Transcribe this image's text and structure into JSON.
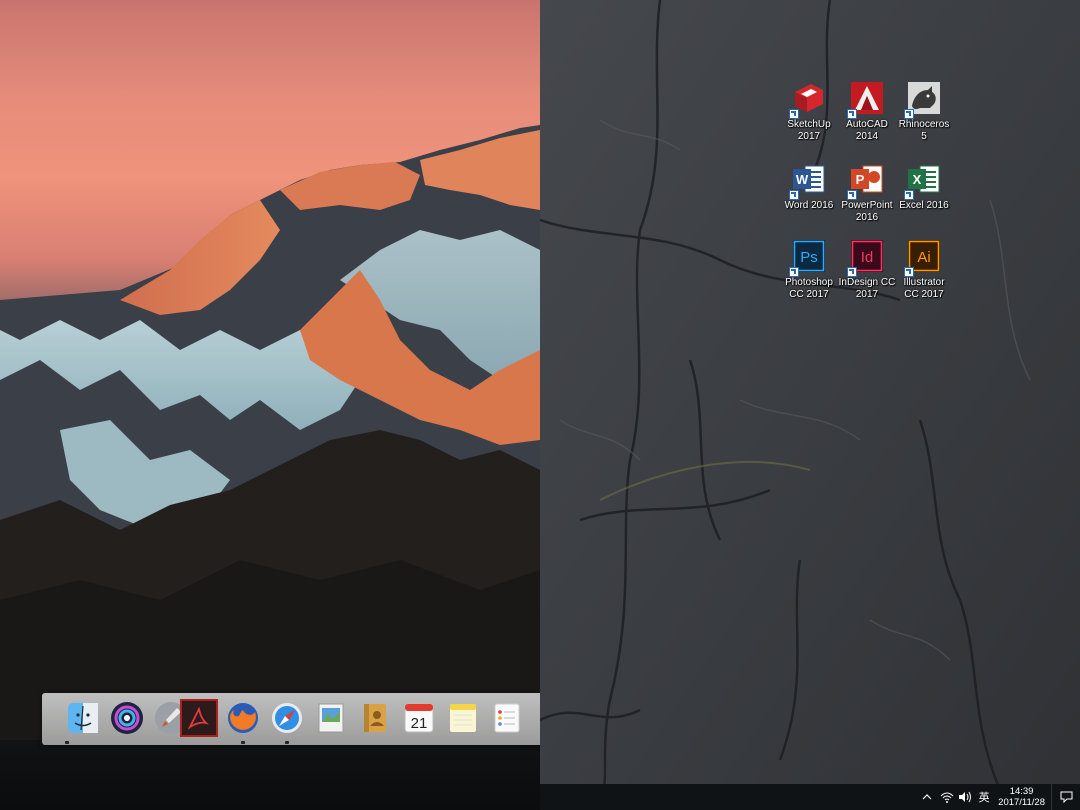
{
  "mac": {
    "dock": {
      "items": [
        {
          "name": "Finder",
          "icon": "finder-icon",
          "running": true
        },
        {
          "name": "Siri",
          "icon": "siri-icon",
          "running": false
        },
        {
          "name": "Launchpad",
          "icon": "launchpad-icon",
          "running": false
        },
        {
          "name": "Adobe Acrobat",
          "icon": "acrobat-icon",
          "running": false
        },
        {
          "name": "Firefox",
          "icon": "firefox-icon",
          "running": true
        },
        {
          "name": "Safari",
          "icon": "safari-icon",
          "running": true
        },
        {
          "name": "Preview",
          "icon": "preview-icon",
          "running": false
        },
        {
          "name": "Contacts",
          "icon": "contacts-icon",
          "running": false
        },
        {
          "name": "Calendar",
          "icon": "calendar-icon",
          "running": false,
          "day": "21"
        },
        {
          "name": "Notes",
          "icon": "notes-icon",
          "running": false
        },
        {
          "name": "Reminders",
          "icon": "reminders-icon",
          "running": false
        }
      ]
    }
  },
  "windows": {
    "desktop_icons": [
      {
        "label": "SketchUp\n2017",
        "icon": "sketchup-icon",
        "color": "#d4262c",
        "glyph": ""
      },
      {
        "label": "AutoCAD\n2014",
        "icon": "autocad-icon",
        "color": "#c41a21",
        "glyph": "A"
      },
      {
        "label": "Rhinoceros\n5",
        "icon": "rhinoceros-icon",
        "color": "#e8e8e8",
        "glyph": ""
      },
      {
        "label": "Word 2016",
        "icon": "word-icon",
        "color": "#2b5797",
        "glyph": "W"
      },
      {
        "label": "PowerPoint\n2016",
        "icon": "powerpoint-icon",
        "color": "#d24726",
        "glyph": "P"
      },
      {
        "label": "Excel 2016",
        "icon": "excel-icon",
        "color": "#217346",
        "glyph": "X"
      },
      {
        "label": "Photoshop\nCC 2017",
        "icon": "photoshop-icon",
        "color": "#31a8ff",
        "glyph": "Ps"
      },
      {
        "label": "InDesign CC\n2017",
        "icon": "indesign-icon",
        "color": "#ff3366",
        "glyph": "Id"
      },
      {
        "label": "Illustrator\nCC 2017",
        "icon": "illustrator-icon",
        "color": "#ff9a00",
        "glyph": "Ai"
      }
    ],
    "taskbar": {
      "ime": "英",
      "time": "14:39",
      "date": "2017/11/28"
    }
  }
}
